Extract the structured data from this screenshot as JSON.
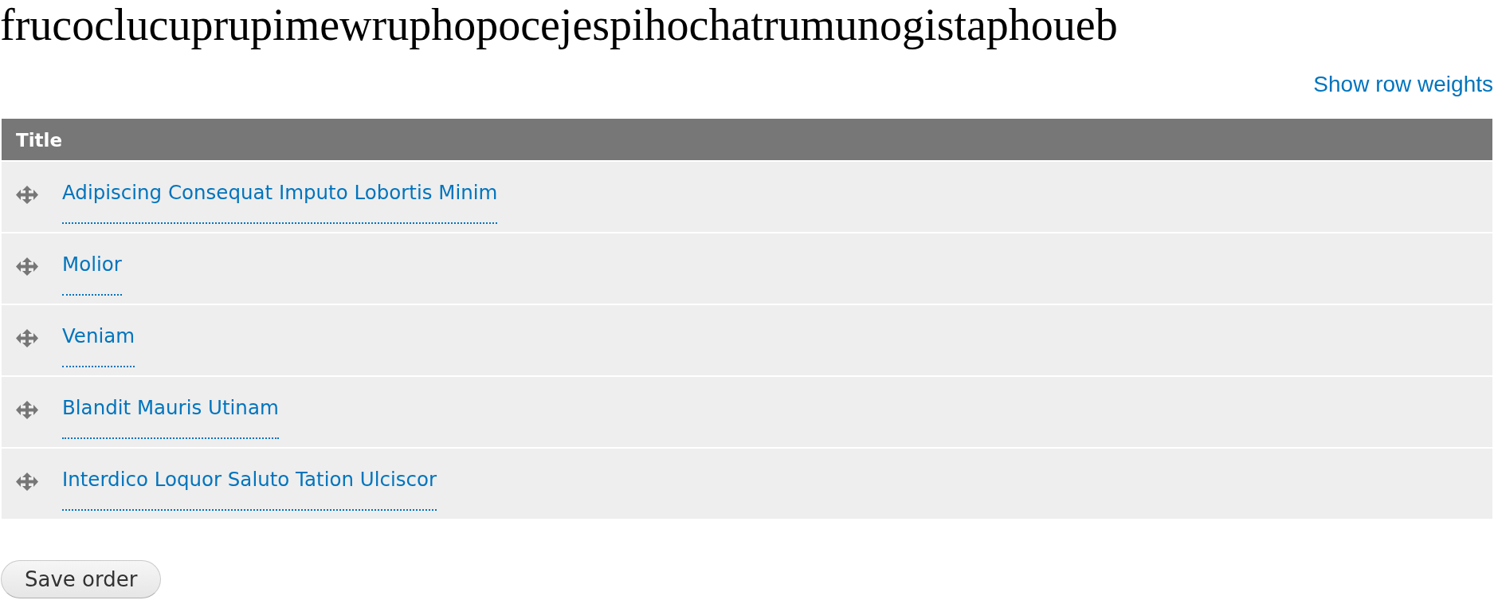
{
  "page": {
    "title": "frucoclucuprupimewruphopocejespihochatrumunogistaphoueb"
  },
  "toggle_link": {
    "label": "Show row weights"
  },
  "table": {
    "columns": [
      "Title"
    ],
    "rows": [
      {
        "title": "Adipiscing Consequat Imputo Lobortis Minim"
      },
      {
        "title": "Molior"
      },
      {
        "title": "Veniam"
      },
      {
        "title": "Blandit Mauris Utinam"
      },
      {
        "title": "Interdico Loquor Saluto Tation Ulciscor"
      }
    ]
  },
  "buttons": [
    {
      "label": "Save order"
    }
  ]
}
